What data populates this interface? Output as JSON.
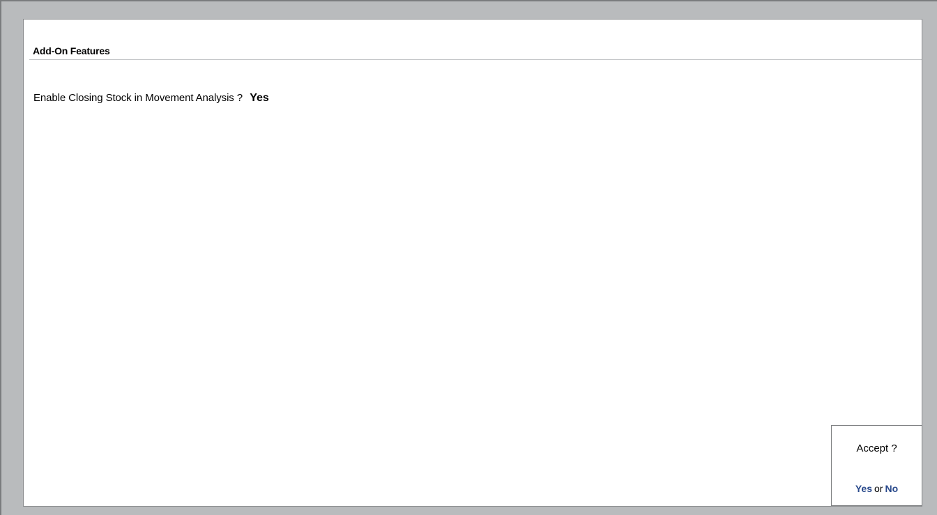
{
  "panel": {
    "title": "Add-On Features"
  },
  "fields": [
    {
      "label": "Enable Closing Stock in Movement Analysis ?",
      "value": "Yes"
    }
  ],
  "accept_dialog": {
    "question": "Accept ?",
    "yes_label": "Yes",
    "separator": "or",
    "no_label": "No",
    "link_color": "#2a4a8c"
  },
  "colors": {
    "background": "#b9bbbd",
    "panel": "#ffffff"
  }
}
